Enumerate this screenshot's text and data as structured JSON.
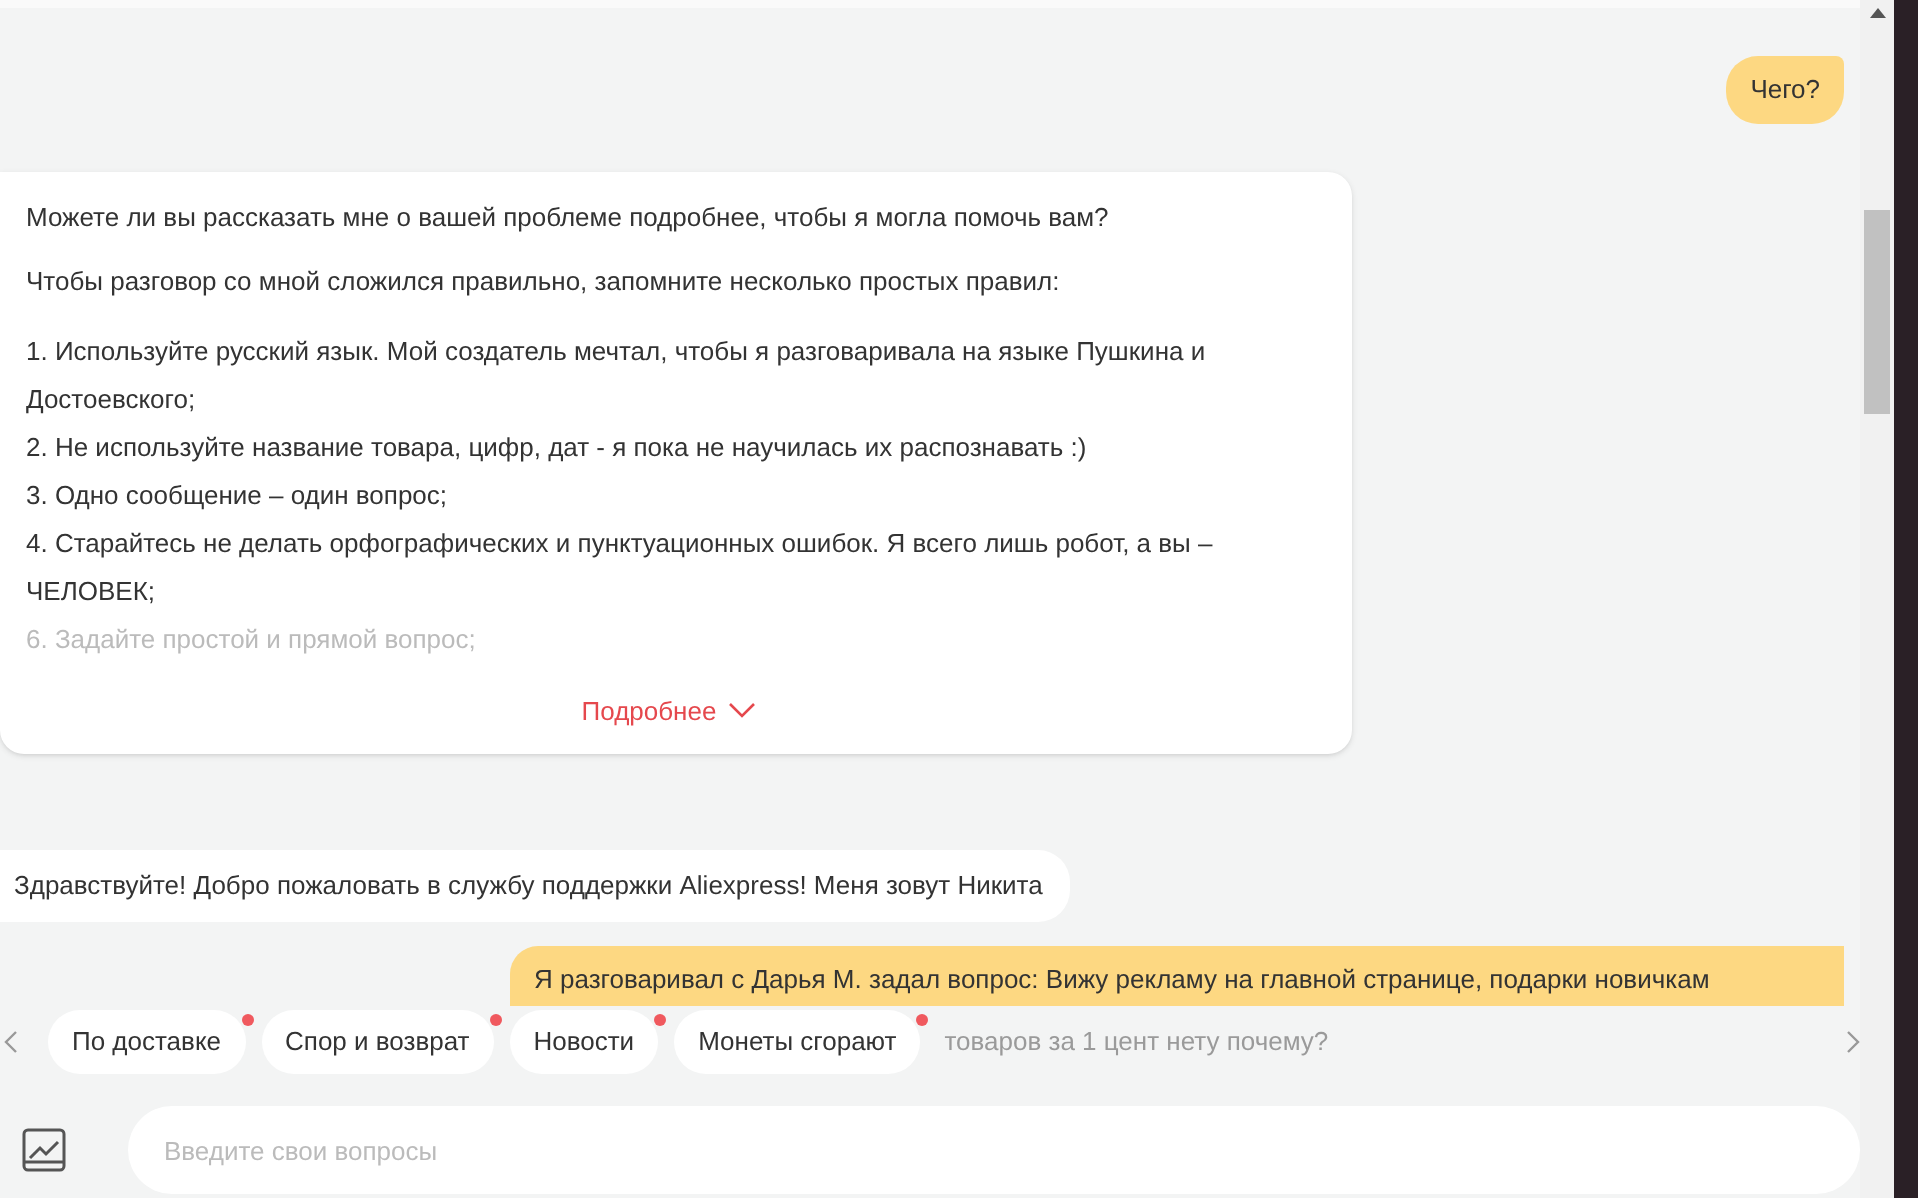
{
  "messages": [
    {
      "kind": "user",
      "text": "Чего?"
    },
    {
      "kind": "bot_card",
      "paragraphs": [
        "Можете ли вы рассказать мне о вашей проблеме подробнее, чтобы я могла помочь вам?",
        "Чтобы разговор со мной сложился правильно, запомните несколько простых правил:"
      ],
      "rules": [
        {
          "text": "1. Используйте русский язык. Мой создатель мечтал, чтобы я разговаривала на языке Пушкина и Достоевского;",
          "faded": false
        },
        {
          "text": "2. Не используйте название товара, цифр, дат - я пока не научилась их распознавать :)",
          "faded": false
        },
        {
          "text": "3. Одно сообщение – один вопрос;",
          "faded": false
        },
        {
          "text": "4. Старайтесь не делать орфографических и пунктуационных ошибок. Я всего лишь робот, а вы – ЧЕЛОВЕК;",
          "faded": false
        },
        {
          "text": "6. Задайте простой и прямой вопрос;",
          "faded": true
        }
      ],
      "more_link": "Подробнее"
    },
    {
      "kind": "bot",
      "text": "Здравствуйте! Добро пожаловать в службу поддержки Aliexpress! Меня зовут Никита"
    },
    {
      "kind": "user_partial",
      "text": "Я разговаривал с Дарья М. задал вопрос: Вижу рекламу на главной странице, подарки новичкам",
      "hidden_line": "товаров за 1 цент нету почему?"
    }
  ],
  "quick_replies": [
    {
      "label": "По доставке",
      "dot": true
    },
    {
      "label": "Спор и возврат",
      "dot": true
    },
    {
      "label": "Новости",
      "dot": true
    },
    {
      "label": "Монеты сгорают",
      "dot": true
    }
  ],
  "input": {
    "placeholder": "Введите свои вопросы"
  }
}
